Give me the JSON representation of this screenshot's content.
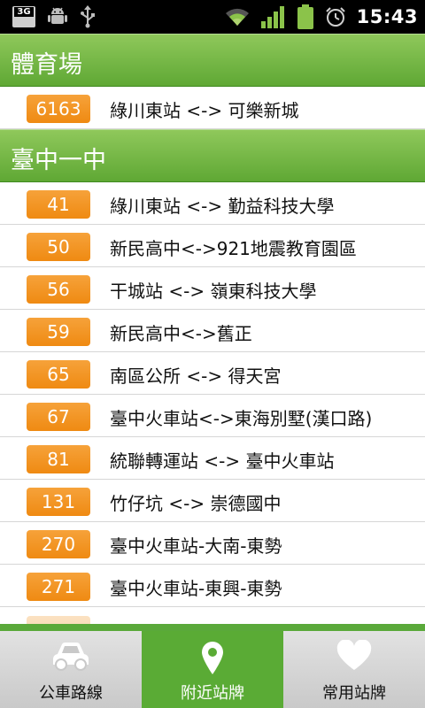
{
  "status_bar": {
    "time": "15:43",
    "network_type": "3G",
    "icons": [
      "3g-icon",
      "android-debug-icon",
      "usb-icon",
      "wifi-icon",
      "signal-icon",
      "battery-icon",
      "alarm-icon"
    ]
  },
  "sections": [
    {
      "title": "體育場",
      "routes": [
        {
          "number": "6163",
          "name": "綠川東站 <-> 可樂新城"
        }
      ]
    },
    {
      "title": "臺中一中",
      "routes": [
        {
          "number": "41",
          "name": "綠川東站 <-> 勤益科技大學"
        },
        {
          "number": "50",
          "name": "新民高中<->921地震教育園區"
        },
        {
          "number": "56",
          "name": "干城站 <-> 嶺東科技大學"
        },
        {
          "number": "59",
          "name": "新民高中<->舊正"
        },
        {
          "number": "65",
          "name": "南區公所 <-> 得天宮"
        },
        {
          "number": "67",
          "name": "臺中火車站<->東海別墅(漢口路)"
        },
        {
          "number": "81",
          "name": "統聯轉運站 <-> 臺中火車站"
        },
        {
          "number": "131",
          "name": "竹仔坑 <-> 崇德國中"
        },
        {
          "number": "270",
          "name": "臺中火車站-大南-東勢"
        },
        {
          "number": "271",
          "name": "臺中火車站-東興-東勢"
        }
      ]
    }
  ],
  "bottom_nav": {
    "tabs": [
      {
        "label": "公車路線",
        "icon": "car-icon",
        "active": false
      },
      {
        "label": "附近站牌",
        "icon": "location-pin-icon",
        "active": true
      },
      {
        "label": "常用站牌",
        "icon": "heart-icon",
        "active": false
      }
    ]
  },
  "colors": {
    "header_green": "#6db442",
    "badge_orange": "#f29320",
    "active_tab": "#5aab35",
    "status_bar": "#000000"
  }
}
